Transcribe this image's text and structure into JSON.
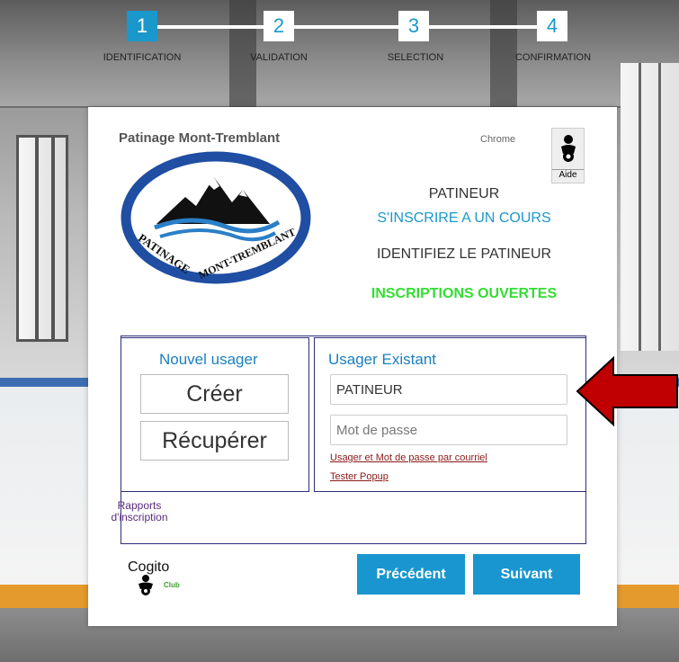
{
  "steps": [
    {
      "num": "1",
      "label": "IDENTIFICATION",
      "active": true
    },
    {
      "num": "2",
      "label": "VALIDATION",
      "active": false
    },
    {
      "num": "3",
      "label": "SELECTION",
      "active": false
    },
    {
      "num": "4",
      "label": "CONFIRMATION",
      "active": false
    }
  ],
  "header": {
    "club_name": "Patinage Mont-Tremblant",
    "browser": "Chrome",
    "help_label": "Aide"
  },
  "logo": {
    "text": "PATINAGE MONT-TREMBLANT"
  },
  "info": {
    "role": "PATINEUR",
    "action": "S'INSCRIRE A UN COURS",
    "instruction": "IDENTIFIEZ LE PATINEUR",
    "status": "INSCRIPTIONS OUVERTES"
  },
  "new_user": {
    "title": "Nouvel usager",
    "create_label": "Créer",
    "recover_label": "Récupérer"
  },
  "existing_user": {
    "title": "Usager Existant",
    "username_value": "PATINEUR",
    "password_placeholder": "Mot de passe",
    "email_link": "Usager et Mot de passe par courriel",
    "popup_link": "Tester Popup"
  },
  "reports": {
    "line1": "Rapports",
    "line2": "d'inscription"
  },
  "footer": {
    "brand_top": "Cogito",
    "brand_sub": "Club",
    "prev_label": "Précédent",
    "next_label": "Suivant"
  },
  "colors": {
    "accent": "#1a98cc",
    "status_green": "#33dd33",
    "frame": "#2c2c7c",
    "arrow": "#c00000"
  }
}
